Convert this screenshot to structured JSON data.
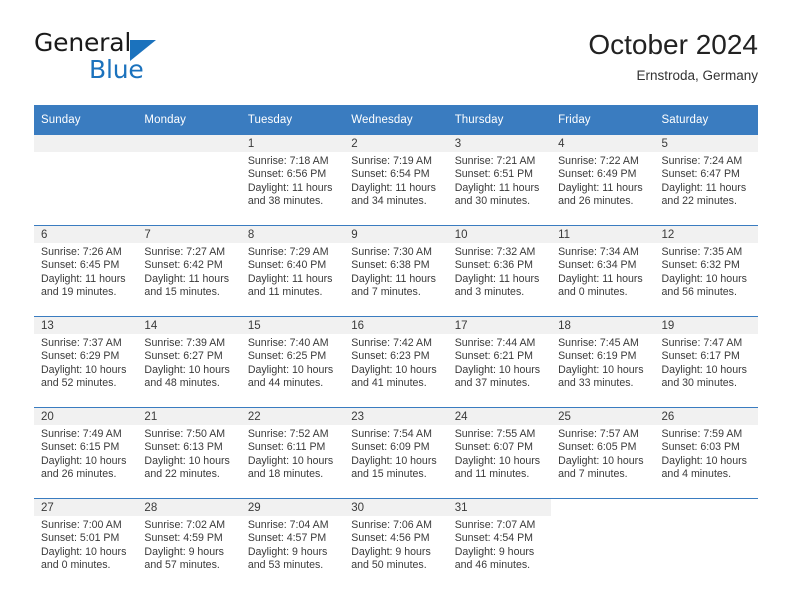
{
  "brand": {
    "name_part1": "General",
    "name_part2": "Blue",
    "triangle_color": "#1b72bd",
    "accent_color": "#3a7cc0"
  },
  "header": {
    "title": "October 2024",
    "subtitle": "Ernstroda, Germany"
  },
  "calendar": {
    "weekday_headers": [
      "Sunday",
      "Monday",
      "Tuesday",
      "Wednesday",
      "Thursday",
      "Friday",
      "Saturday"
    ],
    "weeks": [
      [
        {
          "day": "",
          "lines": []
        },
        {
          "day": "",
          "lines": []
        },
        {
          "day": "1",
          "lines": [
            "Sunrise: 7:18 AM",
            "Sunset: 6:56 PM",
            "Daylight: 11 hours",
            "and 38 minutes."
          ]
        },
        {
          "day": "2",
          "lines": [
            "Sunrise: 7:19 AM",
            "Sunset: 6:54 PM",
            "Daylight: 11 hours",
            "and 34 minutes."
          ]
        },
        {
          "day": "3",
          "lines": [
            "Sunrise: 7:21 AM",
            "Sunset: 6:51 PM",
            "Daylight: 11 hours",
            "and 30 minutes."
          ]
        },
        {
          "day": "4",
          "lines": [
            "Sunrise: 7:22 AM",
            "Sunset: 6:49 PM",
            "Daylight: 11 hours",
            "and 26 minutes."
          ]
        },
        {
          "day": "5",
          "lines": [
            "Sunrise: 7:24 AM",
            "Sunset: 6:47 PM",
            "Daylight: 11 hours",
            "and 22 minutes."
          ]
        }
      ],
      [
        {
          "day": "6",
          "lines": [
            "Sunrise: 7:26 AM",
            "Sunset: 6:45 PM",
            "Daylight: 11 hours",
            "and 19 minutes."
          ]
        },
        {
          "day": "7",
          "lines": [
            "Sunrise: 7:27 AM",
            "Sunset: 6:42 PM",
            "Daylight: 11 hours",
            "and 15 minutes."
          ]
        },
        {
          "day": "8",
          "lines": [
            "Sunrise: 7:29 AM",
            "Sunset: 6:40 PM",
            "Daylight: 11 hours",
            "and 11 minutes."
          ]
        },
        {
          "day": "9",
          "lines": [
            "Sunrise: 7:30 AM",
            "Sunset: 6:38 PM",
            "Daylight: 11 hours",
            "and 7 minutes."
          ]
        },
        {
          "day": "10",
          "lines": [
            "Sunrise: 7:32 AM",
            "Sunset: 6:36 PM",
            "Daylight: 11 hours",
            "and 3 minutes."
          ]
        },
        {
          "day": "11",
          "lines": [
            "Sunrise: 7:34 AM",
            "Sunset: 6:34 PM",
            "Daylight: 11 hours",
            "and 0 minutes."
          ]
        },
        {
          "day": "12",
          "lines": [
            "Sunrise: 7:35 AM",
            "Sunset: 6:32 PM",
            "Daylight: 10 hours",
            "and 56 minutes."
          ]
        }
      ],
      [
        {
          "day": "13",
          "lines": [
            "Sunrise: 7:37 AM",
            "Sunset: 6:29 PM",
            "Daylight: 10 hours",
            "and 52 minutes."
          ]
        },
        {
          "day": "14",
          "lines": [
            "Sunrise: 7:39 AM",
            "Sunset: 6:27 PM",
            "Daylight: 10 hours",
            "and 48 minutes."
          ]
        },
        {
          "day": "15",
          "lines": [
            "Sunrise: 7:40 AM",
            "Sunset: 6:25 PM",
            "Daylight: 10 hours",
            "and 44 minutes."
          ]
        },
        {
          "day": "16",
          "lines": [
            "Sunrise: 7:42 AM",
            "Sunset: 6:23 PM",
            "Daylight: 10 hours",
            "and 41 minutes."
          ]
        },
        {
          "day": "17",
          "lines": [
            "Sunrise: 7:44 AM",
            "Sunset: 6:21 PM",
            "Daylight: 10 hours",
            "and 37 minutes."
          ]
        },
        {
          "day": "18",
          "lines": [
            "Sunrise: 7:45 AM",
            "Sunset: 6:19 PM",
            "Daylight: 10 hours",
            "and 33 minutes."
          ]
        },
        {
          "day": "19",
          "lines": [
            "Sunrise: 7:47 AM",
            "Sunset: 6:17 PM",
            "Daylight: 10 hours",
            "and 30 minutes."
          ]
        }
      ],
      [
        {
          "day": "20",
          "lines": [
            "Sunrise: 7:49 AM",
            "Sunset: 6:15 PM",
            "Daylight: 10 hours",
            "and 26 minutes."
          ]
        },
        {
          "day": "21",
          "lines": [
            "Sunrise: 7:50 AM",
            "Sunset: 6:13 PM",
            "Daylight: 10 hours",
            "and 22 minutes."
          ]
        },
        {
          "day": "22",
          "lines": [
            "Sunrise: 7:52 AM",
            "Sunset: 6:11 PM",
            "Daylight: 10 hours",
            "and 18 minutes."
          ]
        },
        {
          "day": "23",
          "lines": [
            "Sunrise: 7:54 AM",
            "Sunset: 6:09 PM",
            "Daylight: 10 hours",
            "and 15 minutes."
          ]
        },
        {
          "day": "24",
          "lines": [
            "Sunrise: 7:55 AM",
            "Sunset: 6:07 PM",
            "Daylight: 10 hours",
            "and 11 minutes."
          ]
        },
        {
          "day": "25",
          "lines": [
            "Sunrise: 7:57 AM",
            "Sunset: 6:05 PM",
            "Daylight: 10 hours",
            "and 7 minutes."
          ]
        },
        {
          "day": "26",
          "lines": [
            "Sunrise: 7:59 AM",
            "Sunset: 6:03 PM",
            "Daylight: 10 hours",
            "and 4 minutes."
          ]
        }
      ],
      [
        {
          "day": "27",
          "lines": [
            "Sunrise: 7:00 AM",
            "Sunset: 5:01 PM",
            "Daylight: 10 hours",
            "and 0 minutes."
          ]
        },
        {
          "day": "28",
          "lines": [
            "Sunrise: 7:02 AM",
            "Sunset: 4:59 PM",
            "Daylight: 9 hours",
            "and 57 minutes."
          ]
        },
        {
          "day": "29",
          "lines": [
            "Sunrise: 7:04 AM",
            "Sunset: 4:57 PM",
            "Daylight: 9 hours",
            "and 53 minutes."
          ]
        },
        {
          "day": "30",
          "lines": [
            "Sunrise: 7:06 AM",
            "Sunset: 4:56 PM",
            "Daylight: 9 hours",
            "and 50 minutes."
          ]
        },
        {
          "day": "31",
          "lines": [
            "Sunrise: 7:07 AM",
            "Sunset: 4:54 PM",
            "Daylight: 9 hours",
            "and 46 minutes."
          ]
        },
        {
          "day": "",
          "lines": []
        },
        {
          "day": "",
          "lines": []
        }
      ]
    ]
  }
}
